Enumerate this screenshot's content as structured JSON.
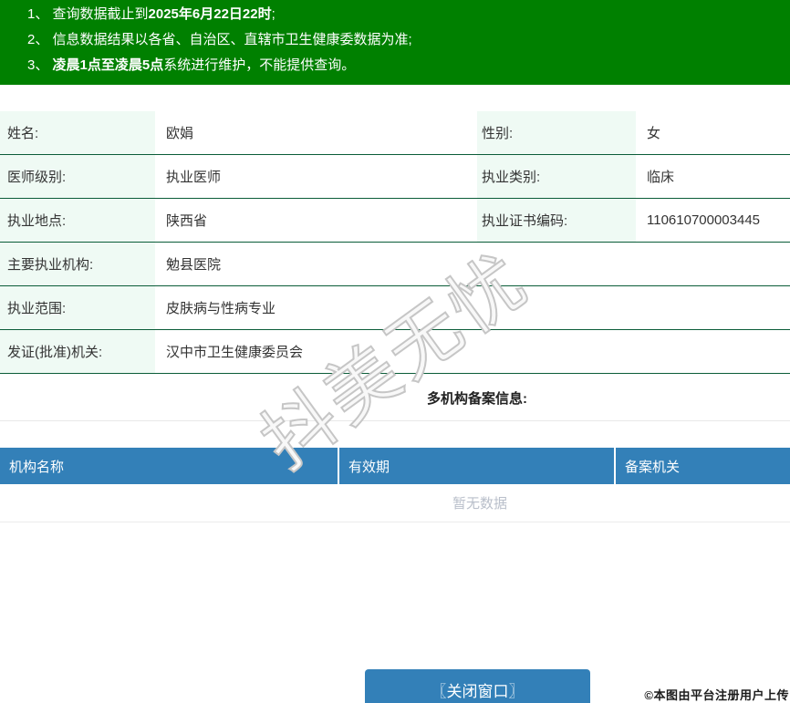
{
  "colors": {
    "banner_green": "#008000",
    "row_divider_green": "#0a5c38",
    "label_cell_bg": "#effaf4",
    "table_header_blue": "#3380b8",
    "button_blue": "#3380b8",
    "empty_text_gray": "#b9bfca"
  },
  "notice": {
    "lines": [
      {
        "pre": "1、 查询数据截止到",
        "bold": "2025年6月22日22时",
        "post": ";"
      },
      {
        "pre": "2、 信息数据结果以各省、自治区、直辖市卫生健康委数据为准;",
        "bold": "",
        "post": ""
      },
      {
        "pre": "3、 ",
        "bold": "凌晨1点至凌晨5点",
        "post": "系统进行维护，不能提供查询。"
      }
    ]
  },
  "doctor": {
    "rows": [
      {
        "label": "姓名:",
        "value": "欧娟",
        "label2": "性别:",
        "value2": "女"
      },
      {
        "label": "医师级别:",
        "value": "执业医师",
        "label2": "执业类别:",
        "value2": "临床"
      },
      {
        "label": "执业地点:",
        "value": "陕西省",
        "label2": "执业证书编码:",
        "value2": "110610700003445"
      },
      {
        "label": "主要执业机构:",
        "value": "勉县医院"
      },
      {
        "label": "执业范围:",
        "value": "皮肤病与性病专业"
      },
      {
        "label": "发证(批准)机关:",
        "value": "汉中市卫生健康委员会"
      }
    ]
  },
  "registration": {
    "heading": "多机构备案信息:",
    "headers": [
      "机构名称",
      "有效期",
      "备案机关"
    ],
    "empty_text": "暂无数据"
  },
  "footer": {
    "close_button": "〖关闭窗口〗",
    "copyright": "©本图由平台注册用户上传"
  },
  "watermark_text": "抖美无忧"
}
